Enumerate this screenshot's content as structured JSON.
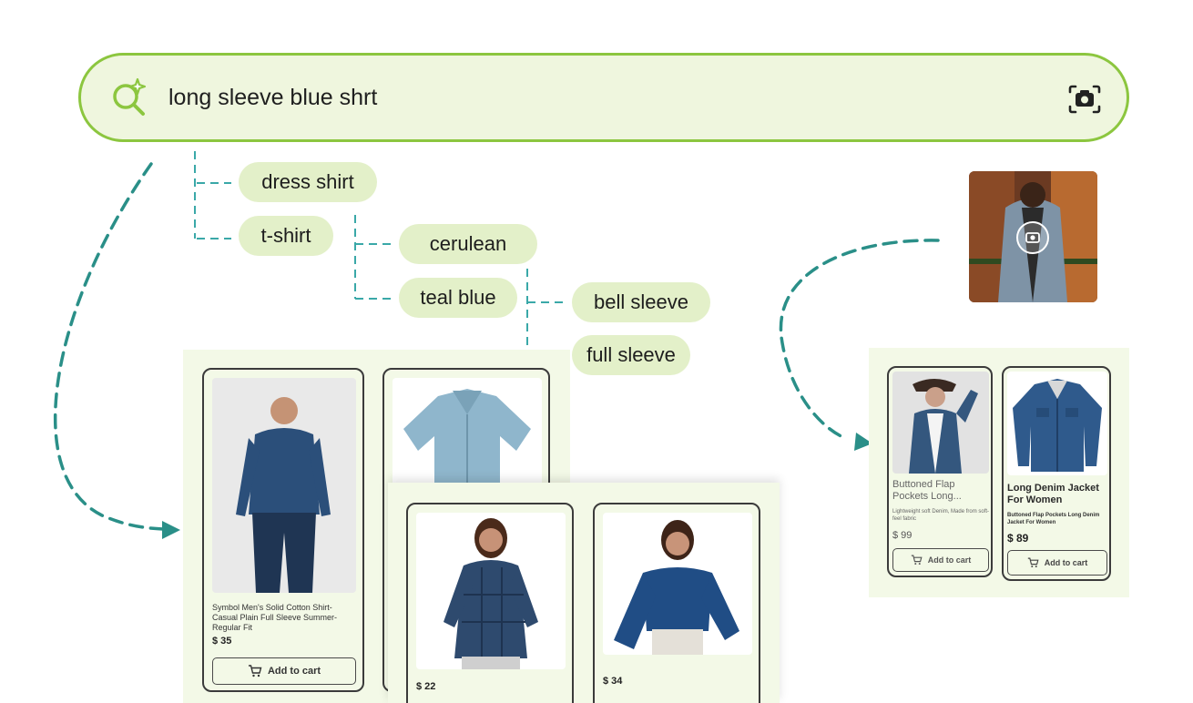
{
  "search": {
    "query": "long sleeve blue shrt",
    "icons": {
      "search": "sparkle-search-icon",
      "camera": "camera-icon"
    }
  },
  "suggestions": {
    "level1": [
      "dress shirt",
      "t-shirt"
    ],
    "level2": [
      "cerulean",
      "teal blue"
    ],
    "level3": [
      "bell sleeve",
      "full sleeve"
    ]
  },
  "text_results": {
    "products": [
      {
        "title": "Symbol Men's Solid Cotton Shirt- Casual Plain Full Sleeve Summer-Regular Fit",
        "price": "$ 35",
        "cta": "Add to cart"
      },
      {
        "title": "",
        "price": "",
        "cta": ""
      },
      {
        "title": "",
        "price": "$ 22",
        "cta": ""
      },
      {
        "title": "",
        "price": "$ 34",
        "cta": ""
      }
    ]
  },
  "image_results": {
    "products": [
      {
        "title": "Buttoned Flap Pockets Long...",
        "subtitle": "Lightweight soft Denim, Made from soft-feel fabric",
        "price": "$ 99",
        "cta": "Add to cart"
      },
      {
        "title": "Long Denim Jacket For Women",
        "subtitle": "Buttoned Flap Pockets Long Denim Jacket For Women",
        "price": "$ 89",
        "cta": "Add to cart"
      }
    ]
  },
  "colors": {
    "accent": "#8cc63f",
    "bar_bg": "#eff6de",
    "chip_bg": "#e3f0c9",
    "panel_bg": "#f3f9e7",
    "connector": "#3aa8a8",
    "arrow": "#2a8f88"
  }
}
